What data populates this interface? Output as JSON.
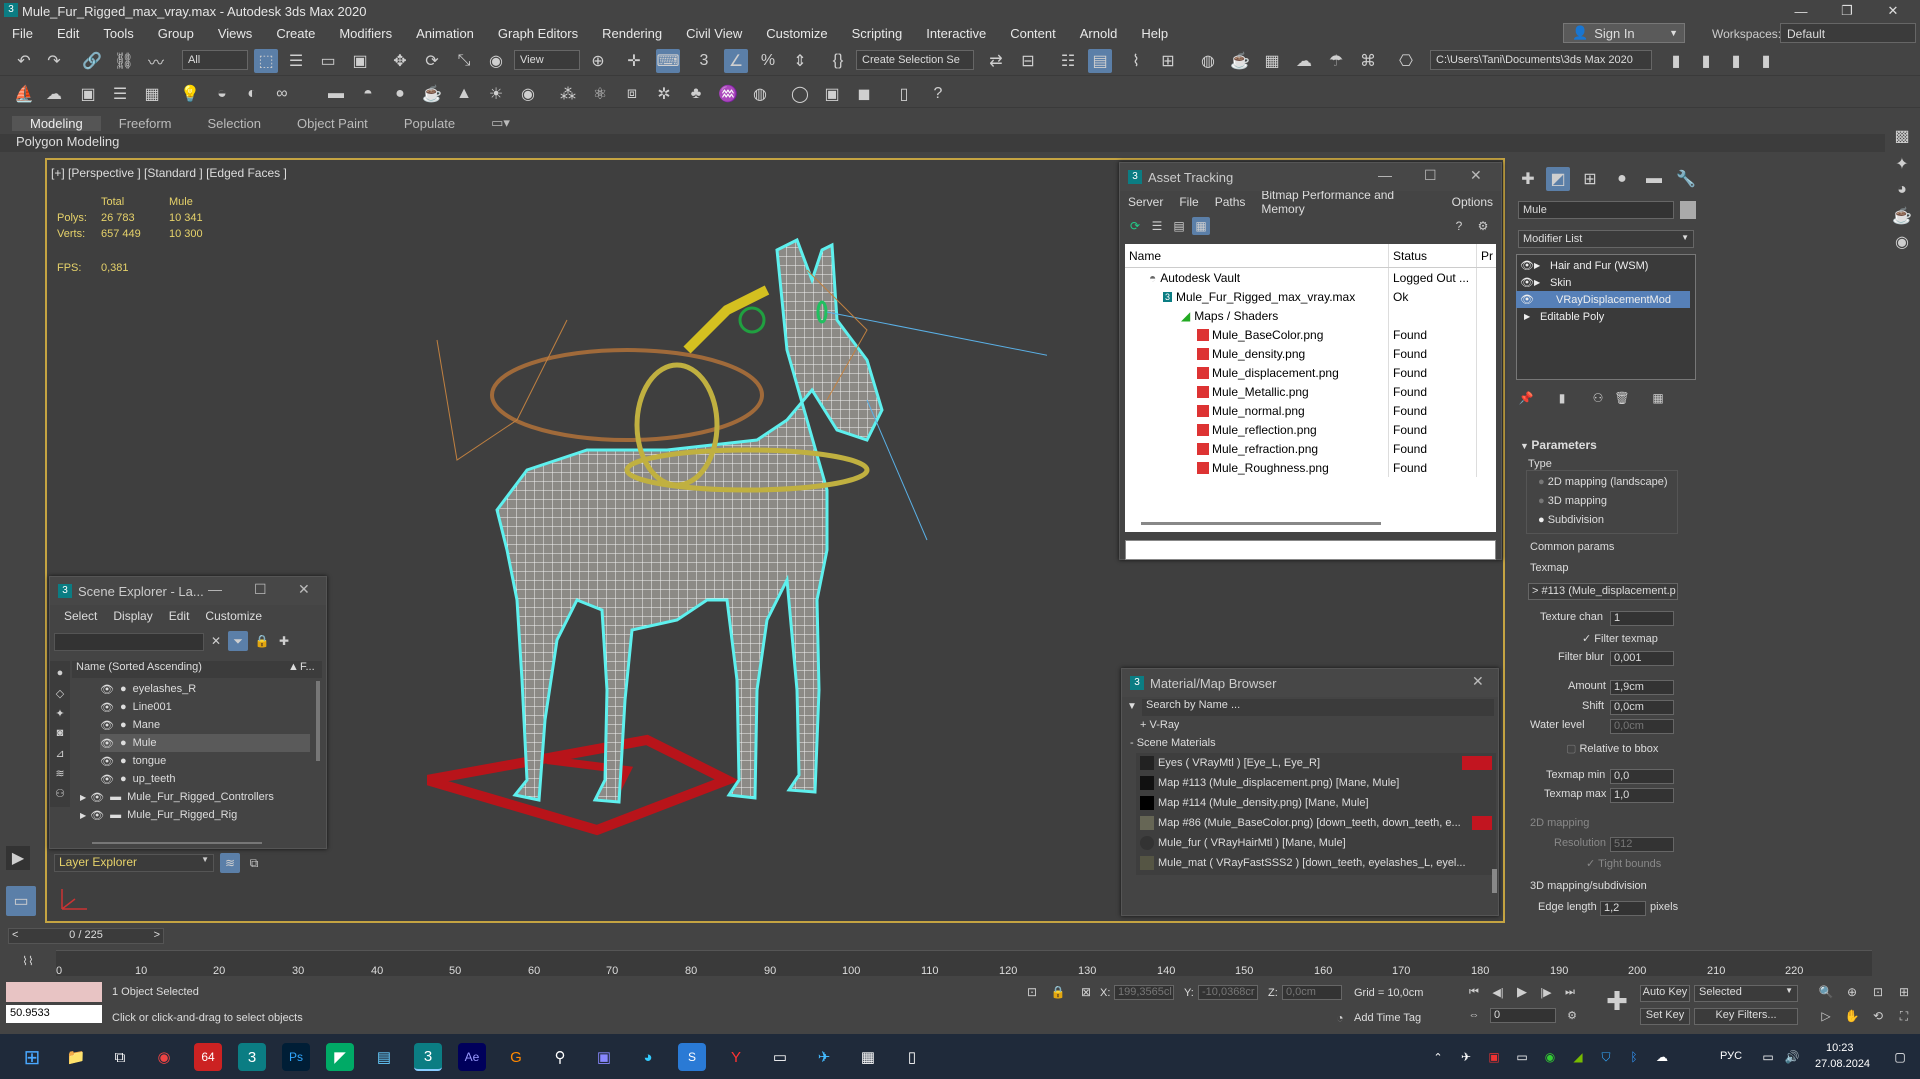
{
  "app": {
    "title": "Mule_Fur_Rigged_max_vray.max - Autodesk 3ds Max 2020"
  },
  "menu": [
    "File",
    "Edit",
    "Tools",
    "Group",
    "Views",
    "Create",
    "Modifiers",
    "Animation",
    "Graph Editors",
    "Rendering",
    "Civil View",
    "Customize",
    "Scripting",
    "Interactive",
    "Content",
    "Arnold",
    "Help"
  ],
  "signin": "Sign In",
  "workspaces": {
    "label": "Workspaces:",
    "value": "Default"
  },
  "toolbar": {
    "selection_filter": "All",
    "ref_coord": "View",
    "create_selection_set": "Create Selection Se",
    "project_path": "C:\\Users\\Tani\\Documents\\3ds Max 2020"
  },
  "ribbon": {
    "tabs": [
      "Modeling",
      "Freeform",
      "Selection",
      "Object Paint",
      "Populate"
    ],
    "sub": "Polygon Modeling"
  },
  "viewport": {
    "label": "[+] [Perspective ] [Standard ] [Edged Faces ]",
    "stats": {
      "total_h": "Total",
      "obj_h": "Mule",
      "polys_l": "Polys:",
      "polys_t": "26 783",
      "polys_o": "10 341",
      "verts_l": "Verts:",
      "verts_t": "657 449",
      "verts_o": "10 300",
      "fps_l": "FPS:",
      "fps_v": "0,381"
    }
  },
  "asset": {
    "title": "Asset Tracking",
    "menu": [
      "Server",
      "File",
      "Paths",
      "Bitmap Performance and Memory",
      "Options"
    ],
    "cols": [
      "Name",
      "Status",
      "Pr"
    ],
    "rows": [
      {
        "n": "Autodesk Vault",
        "s": "Logged Out ..."
      },
      {
        "n": "Mule_Fur_Rigged_max_vray.max",
        "s": "Ok"
      },
      {
        "n": "Maps / Shaders",
        "s": ""
      },
      {
        "n": "Mule_BaseColor.png",
        "s": "Found"
      },
      {
        "n": "Mule_density.png",
        "s": "Found"
      },
      {
        "n": "Mule_displacement.png",
        "s": "Found"
      },
      {
        "n": "Mule_Metallic.png",
        "s": "Found"
      },
      {
        "n": "Mule_normal.png",
        "s": "Found"
      },
      {
        "n": "Mule_reflection.png",
        "s": "Found"
      },
      {
        "n": "Mule_refraction.png",
        "s": "Found"
      },
      {
        "n": "Mule_Roughness.png",
        "s": "Found"
      }
    ]
  },
  "scene": {
    "title": "Scene Explorer - La...",
    "menu": [
      "Select",
      "Display",
      "Edit",
      "Customize"
    ],
    "header": "Name (Sorted Ascending)",
    "hdr2": "F...",
    "items": [
      "eyelashes_R",
      "Line001",
      "Mane",
      "Mule",
      "tongue",
      "up_teeth",
      "Mule_Fur_Rigged_Controllers",
      "Mule_Fur_Rigged_Rig"
    ],
    "layer": "Layer Explorer"
  },
  "matbrowser": {
    "title": "Material/Map Browser",
    "search": "Search by Name ...",
    "vray": "+ V-Ray",
    "section": "- Scene Materials",
    "items": [
      "Eyes ( VRayMtl ) [Eye_L, Eye_R]",
      "Map #113 (Mule_displacement.png) [Mane, Mule]",
      "Map #114 (Mule_density.png) [Mane, Mule]",
      "Map #86 (Mule_BaseColor.png) [down_teeth, down_teeth, e...",
      "Mule_fur ( VRayHairMtl ) [Mane, Mule]",
      "Mule_mat ( VRayFastSSS2 ) [down_teeth, eyelashes_L, eyel..."
    ]
  },
  "cmd": {
    "objname": "Mule",
    "modlist": "Modifier List",
    "stack": [
      "Hair and Fur (WSM)",
      "Skin",
      "VRayDisplacementMod",
      "Editable Poly"
    ],
    "params": "Parameters",
    "type": "Type",
    "opt1": "2D mapping (landscape)",
    "opt2": "3D mapping",
    "opt3": "Subdivision",
    "common": "Common params",
    "texmap": "Texmap",
    "texmap_v": "> #113 (Mule_displacement.p",
    "texchan_l": "Texture chan",
    "texchan_v": "1",
    "filter": "Filter texmap",
    "fblur_l": "Filter blur",
    "fblur_v": "0,001",
    "amount_l": "Amount",
    "amount_v": "1,9cm",
    "shift_l": "Shift",
    "shift_v": "0,0cm",
    "water_l": "Water level",
    "water_v": "0,0cm",
    "relbbox": "Relative to bbox",
    "tmin_l": "Texmap min",
    "tmin_v": "0,0",
    "tmax_l": "Texmap max",
    "tmax_v": "1,0",
    "map2d": "2D mapping",
    "res_l": "Resolution",
    "res_v": "512",
    "tight": "Tight bounds",
    "map3d": "3D mapping/subdivision",
    "edge_l": "Edge length",
    "edge_v": "1,2",
    "pixels": "pixels"
  },
  "timeline": {
    "frame": "0 / 225",
    "ticks": [
      "0",
      "10",
      "20",
      "30",
      "40",
      "50",
      "60",
      "70",
      "80",
      "90",
      "100",
      "110",
      "120",
      "130",
      "140",
      "150",
      "160",
      "170",
      "180",
      "190",
      "200",
      "210",
      "220"
    ]
  },
  "status": {
    "selected": "1 Object Selected",
    "hint": "Click or click-and-drag to select objects",
    "script_val": "50.9533",
    "x_l": "X:",
    "x_v": "199,3565cl",
    "y_l": "Y:",
    "y_v": "-10,0368cr",
    "z_l": "Z:",
    "z_v": "0,0cm",
    "grid": "Grid = 10,0cm",
    "addtime": "Add Time Tag",
    "autokey": "Auto Key",
    "selected_dd": "Selected",
    "setkey": "Set Key",
    "keyfilters": "Key Filters...",
    "frame_v": "0"
  },
  "taskbar": {
    "lang": "РУС",
    "time": "10:23",
    "date": "27.08.2024"
  }
}
